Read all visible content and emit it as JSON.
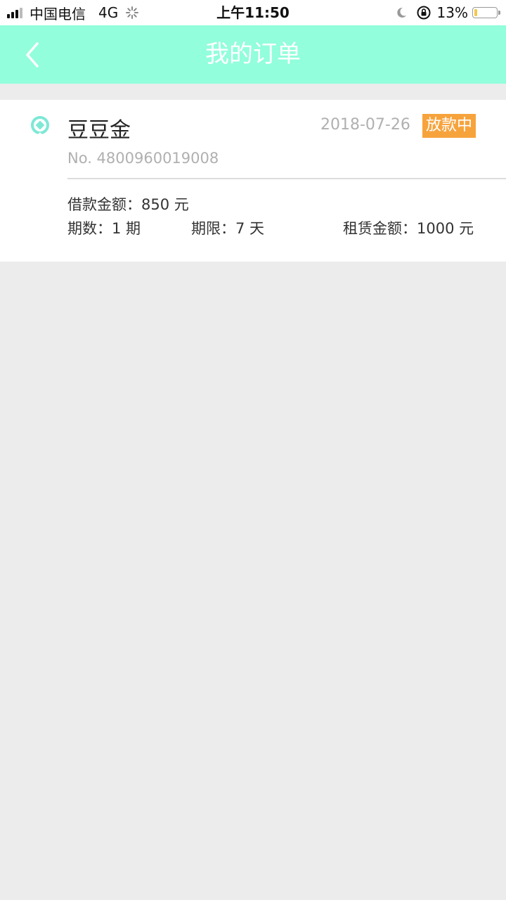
{
  "status_bar": {
    "carrier": "中国电信",
    "network": "4G",
    "time": "上午11:50",
    "battery_percent": "13%",
    "battery_level": 0.13
  },
  "nav": {
    "title": "我的订单",
    "back_icon": "chevron-left-icon"
  },
  "order": {
    "product_name": "豆豆金",
    "date": "2018-07-26",
    "status": "放款中",
    "status_color": "#f7a33c",
    "order_no": "No. 4800960019008",
    "loan_amount": "借款金额：850 元",
    "periods": "期数：1 期",
    "term": "期限：7 天",
    "lease_amount": "租赁金额：1000 元"
  },
  "colors": {
    "header_bg": "#92fedb",
    "page_bg": "#ececec",
    "brand_icon": "#7ee8d6"
  }
}
